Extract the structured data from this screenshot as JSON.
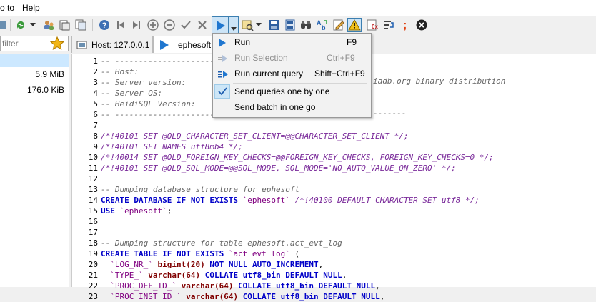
{
  "menubar": {
    "goto": "o to",
    "help": "Help"
  },
  "filter": {
    "placeholder": "filter"
  },
  "tree": {
    "sizes": [
      "5.9 MiB",
      "176.0 KiB"
    ]
  },
  "tabs": [
    {
      "label": "Host: 127.0.0.1"
    },
    {
      "label": "ephesoft.sq"
    }
  ],
  "dropdown": {
    "items": [
      {
        "label": "Run",
        "shortcut": "F9"
      },
      {
        "label": "Run Selection",
        "shortcut": "Ctrl+F9"
      },
      {
        "label": "Run current query",
        "shortcut": "Shift+Ctrl+F9"
      },
      {
        "label": "Send queries one by one"
      },
      {
        "label": "Send batch in one go"
      }
    ]
  },
  "editor": {
    "hidden_right": {
      "line3": "iadb.org binary distribution",
      "line6": "-------"
    },
    "lines": [
      {
        "n": "1",
        "parts": [
          {
            "t": "-- ----------------------------",
            "c": "cmt"
          }
        ]
      },
      {
        "n": "2",
        "parts": [
          {
            "t": "-- Host:",
            "c": "cmt"
          }
        ]
      },
      {
        "n": "3",
        "parts": [
          {
            "t": "-- Server version:",
            "c": "cmt"
          }
        ]
      },
      {
        "n": "4",
        "parts": [
          {
            "t": "-- Server OS:",
            "c": "cmt"
          }
        ]
      },
      {
        "n": "5",
        "parts": [
          {
            "t": "-- HeidiSQL Version:",
            "c": "cmt"
          }
        ]
      },
      {
        "n": "6",
        "parts": [
          {
            "t": "-- ----------------------------",
            "c": "cmt"
          }
        ]
      },
      {
        "n": "7",
        "parts": []
      },
      {
        "n": "8",
        "parts": [
          {
            "t": "/*!40101 SET @OLD_CHARACTER_SET_CLIENT=@@CHARACTER_SET_CLIENT */;",
            "c": "cnd"
          }
        ]
      },
      {
        "n": "9",
        "parts": [
          {
            "t": "/*!40101 SET NAMES utf8mb4 */;",
            "c": "cnd"
          }
        ]
      },
      {
        "n": "10",
        "parts": [
          {
            "t": "/*!40014 SET @OLD_FOREIGN_KEY_CHECKS=@@FOREIGN_KEY_CHECKS, FOREIGN_KEY_CHECKS=0 */;",
            "c": "cnd"
          }
        ]
      },
      {
        "n": "11",
        "parts": [
          {
            "t": "/*!40101 SET @OLD_SQL_MODE=@@SQL_MODE, SQL_MODE='NO_AUTO_VALUE_ON_ZERO' */;",
            "c": "cnd"
          }
        ]
      },
      {
        "n": "12",
        "parts": []
      },
      {
        "n": "13",
        "parts": [
          {
            "t": "-- Dumping database structure for ephesoft",
            "c": "cmt"
          }
        ]
      },
      {
        "n": "14",
        "parts": [
          {
            "t": "CREATE DATABASE IF NOT EXISTS ",
            "c": "kw"
          },
          {
            "t": "`ephesoft`",
            "c": "id"
          },
          {
            "t": " /*!40100 DEFAULT CHARACTER SET utf8 */;",
            "c": "cnd"
          }
        ]
      },
      {
        "n": "15",
        "parts": [
          {
            "t": "USE ",
            "c": "kw"
          },
          {
            "t": "`ephesoft`",
            "c": "id"
          },
          {
            "t": ";",
            "c": ""
          }
        ]
      },
      {
        "n": "16",
        "parts": []
      },
      {
        "n": "17",
        "parts": []
      },
      {
        "n": "18",
        "parts": [
          {
            "t": "-- Dumping structure for table ephesoft.act_evt_log",
            "c": "cmt"
          }
        ]
      },
      {
        "n": "19",
        "parts": [
          {
            "t": "CREATE TABLE IF NOT EXISTS ",
            "c": "kw"
          },
          {
            "t": "`act_evt_log`",
            "c": "id"
          },
          {
            "t": " (",
            "c": ""
          }
        ]
      },
      {
        "n": "20",
        "parts": [
          {
            "t": "  `LOG_NR_`",
            "c": "id"
          },
          {
            "t": " bigint(20) ",
            "c": "dt"
          },
          {
            "t": "NOT NULL AUTO_INCREMENT",
            "c": "kw"
          },
          {
            "t": ",",
            "c": ""
          }
        ]
      },
      {
        "n": "21",
        "parts": [
          {
            "t": "  `TYPE_`",
            "c": "id"
          },
          {
            "t": " varchar(64) ",
            "c": "dt"
          },
          {
            "t": "COLLATE utf8_bin DEFAULT NULL",
            "c": "kw"
          },
          {
            "t": ",",
            "c": ""
          }
        ]
      },
      {
        "n": "22",
        "parts": [
          {
            "t": "  `PROC_DEF_ID_`",
            "c": "id"
          },
          {
            "t": " varchar(64) ",
            "c": "dt"
          },
          {
            "t": "COLLATE utf8_bin DEFAULT NULL",
            "c": "kw"
          },
          {
            "t": ",",
            "c": ""
          }
        ]
      },
      {
        "n": "23",
        "parts": [
          {
            "t": "  `PROC_INST_ID_`",
            "c": "id"
          },
          {
            "t": " varchar(64) ",
            "c": "dt"
          },
          {
            "t": "COLLATE utf8_bin DEFAULT NULL",
            "c": "kw"
          },
          {
            "t": ",",
            "c": ""
          }
        ]
      }
    ]
  },
  "colors": {
    "accent": "#3c7fb1",
    "highlight": "#cce4f7",
    "tree_selected": "#cce8ff"
  }
}
